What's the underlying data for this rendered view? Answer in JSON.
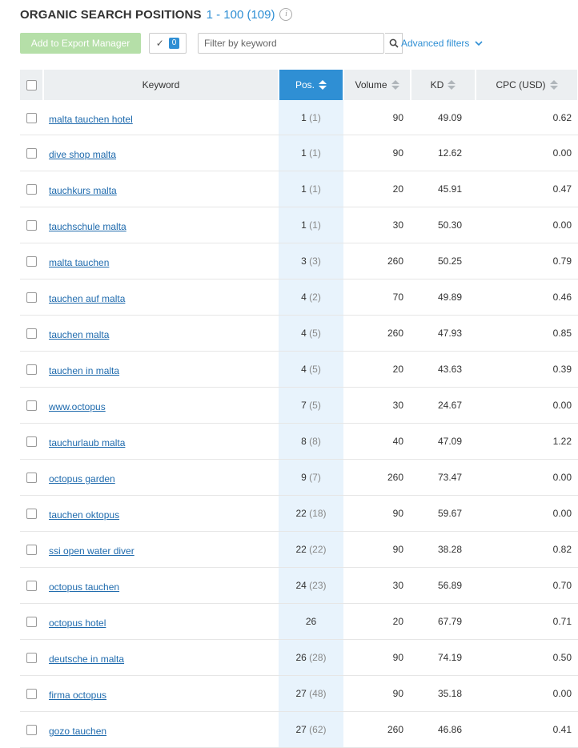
{
  "header": {
    "title": "ORGANIC SEARCH POSITIONS",
    "range": "1 - 100 (109)",
    "info_icon": "info-icon"
  },
  "toolbar": {
    "export_label": "Add to Export Manager",
    "selected_count": "0",
    "filter_placeholder": "Filter by keyword",
    "filter_value": "",
    "advanced_filters_label": "Advanced filters",
    "colors": {
      "accent": "#2f8fd4",
      "export_disabled": "#b5dfa8",
      "link": "#1e6aad"
    }
  },
  "table": {
    "columns": {
      "keyword": "Keyword",
      "pos": "Pos.",
      "volume": "Volume",
      "kd": "KD",
      "cpc": "CPC (USD)"
    },
    "sorted_by": "Pos.",
    "rows": [
      {
        "keyword": "malta tauchen hotel",
        "pos": "1",
        "prev": "(1)",
        "volume": "90",
        "kd": "49.09",
        "cpc": "0.62"
      },
      {
        "keyword": "dive shop malta",
        "pos": "1",
        "prev": "(1)",
        "volume": "90",
        "kd": "12.62",
        "cpc": "0.00"
      },
      {
        "keyword": "tauchkurs malta",
        "pos": "1",
        "prev": "(1)",
        "volume": "20",
        "kd": "45.91",
        "cpc": "0.47"
      },
      {
        "keyword": "tauchschule malta",
        "pos": "1",
        "prev": "(1)",
        "volume": "30",
        "kd": "50.30",
        "cpc": "0.00"
      },
      {
        "keyword": "malta tauchen",
        "pos": "3",
        "prev": "(3)",
        "volume": "260",
        "kd": "50.25",
        "cpc": "0.79"
      },
      {
        "keyword": "tauchen auf malta",
        "pos": "4",
        "prev": "(2)",
        "volume": "70",
        "kd": "49.89",
        "cpc": "0.46"
      },
      {
        "keyword": "tauchen malta",
        "pos": "4",
        "prev": "(5)",
        "volume": "260",
        "kd": "47.93",
        "cpc": "0.85"
      },
      {
        "keyword": "tauchen in malta",
        "pos": "4",
        "prev": "(5)",
        "volume": "20",
        "kd": "43.63",
        "cpc": "0.39"
      },
      {
        "keyword": "www.octopus",
        "pos": "7",
        "prev": "(5)",
        "volume": "30",
        "kd": "24.67",
        "cpc": "0.00"
      },
      {
        "keyword": "tauchurlaub malta",
        "pos": "8",
        "prev": "(8)",
        "volume": "40",
        "kd": "47.09",
        "cpc": "1.22"
      },
      {
        "keyword": "octopus garden",
        "pos": "9",
        "prev": "(7)",
        "volume": "260",
        "kd": "73.47",
        "cpc": "0.00"
      },
      {
        "keyword": "tauchen oktopus",
        "pos": "22",
        "prev": "(18)",
        "volume": "90",
        "kd": "59.67",
        "cpc": "0.00"
      },
      {
        "keyword": "ssi open water diver",
        "pos": "22",
        "prev": "(22)",
        "volume": "90",
        "kd": "38.28",
        "cpc": "0.82"
      },
      {
        "keyword": "octopus tauchen",
        "pos": "24",
        "prev": "(23)",
        "volume": "30",
        "kd": "56.89",
        "cpc": "0.70"
      },
      {
        "keyword": "octopus hotel",
        "pos": "26",
        "prev": "",
        "volume": "20",
        "kd": "67.79",
        "cpc": "0.71"
      },
      {
        "keyword": "deutsche in malta",
        "pos": "26",
        "prev": "(28)",
        "volume": "90",
        "kd": "74.19",
        "cpc": "0.50"
      },
      {
        "keyword": "firma octopus",
        "pos": "27",
        "prev": "(48)",
        "volume": "90",
        "kd": "35.18",
        "cpc": "0.00"
      },
      {
        "keyword": "gozo tauchen",
        "pos": "27",
        "prev": "(62)",
        "volume": "260",
        "kd": "46.86",
        "cpc": "0.41"
      }
    ]
  }
}
